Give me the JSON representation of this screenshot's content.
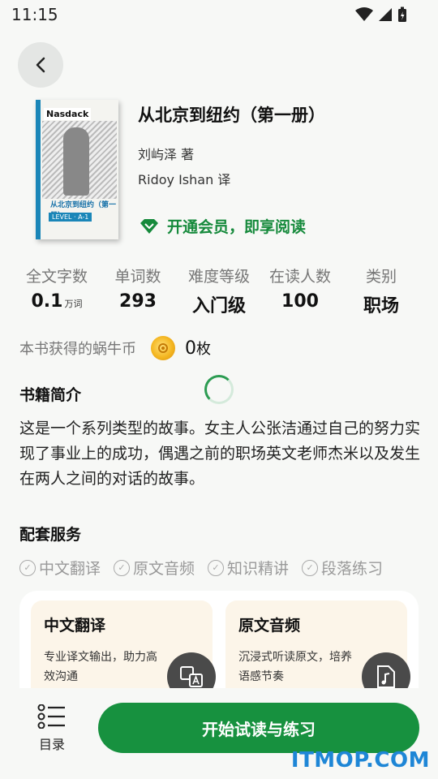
{
  "status_bar": {
    "time": "11:15"
  },
  "book": {
    "cover_brand": "Nasdack",
    "cover_title": "从北京到纽约（第一册）",
    "cover_level": "LEVEL · A-1",
    "title": "从北京到纽约（第一册）",
    "author": "刘屿泽 著",
    "translator": "Ridoy Ishan 译"
  },
  "vip": {
    "label": "开通会员，即享阅读"
  },
  "stats": [
    {
      "label": "全文字数",
      "value": "0.1",
      "unit": "万词"
    },
    {
      "label": "单词数",
      "value": "293",
      "unit": ""
    },
    {
      "label": "难度等级",
      "value": "入门级",
      "unit": ""
    },
    {
      "label": "在读人数",
      "value": "100",
      "unit": ""
    },
    {
      "label": "类别",
      "value": "职场",
      "unit": ""
    }
  ],
  "coins": {
    "label": "本书获得的蜗牛币",
    "count": "0",
    "unit": "枚"
  },
  "intro": {
    "title": "书籍简介",
    "text": "这是一个系列类型的故事。女主人公张洁通过自己的努力实现了事业上的成功，偶遇之前的职场英文老师杰米以及发生在两人之间的对话的故事。"
  },
  "services": {
    "title": "配套服务",
    "tags": [
      "中文翻译",
      "原文音频",
      "知识精讲",
      "段落练习"
    ],
    "cards": [
      {
        "title": "中文翻译",
        "desc": "专业译文输出，助力高效沟通",
        "icon": "translate-icon"
      },
      {
        "title": "原文音频",
        "desc": "沉浸式听读原文，培养语感节奏",
        "icon": "audio-file-icon"
      }
    ]
  },
  "bottom": {
    "toc_label": "目录",
    "start_label": "开始试读与练习"
  },
  "watermark": "ITMOP.COM",
  "colors": {
    "accent": "#17913f",
    "vip": "#168a3c",
    "card_bg": "#fcf5e9"
  }
}
